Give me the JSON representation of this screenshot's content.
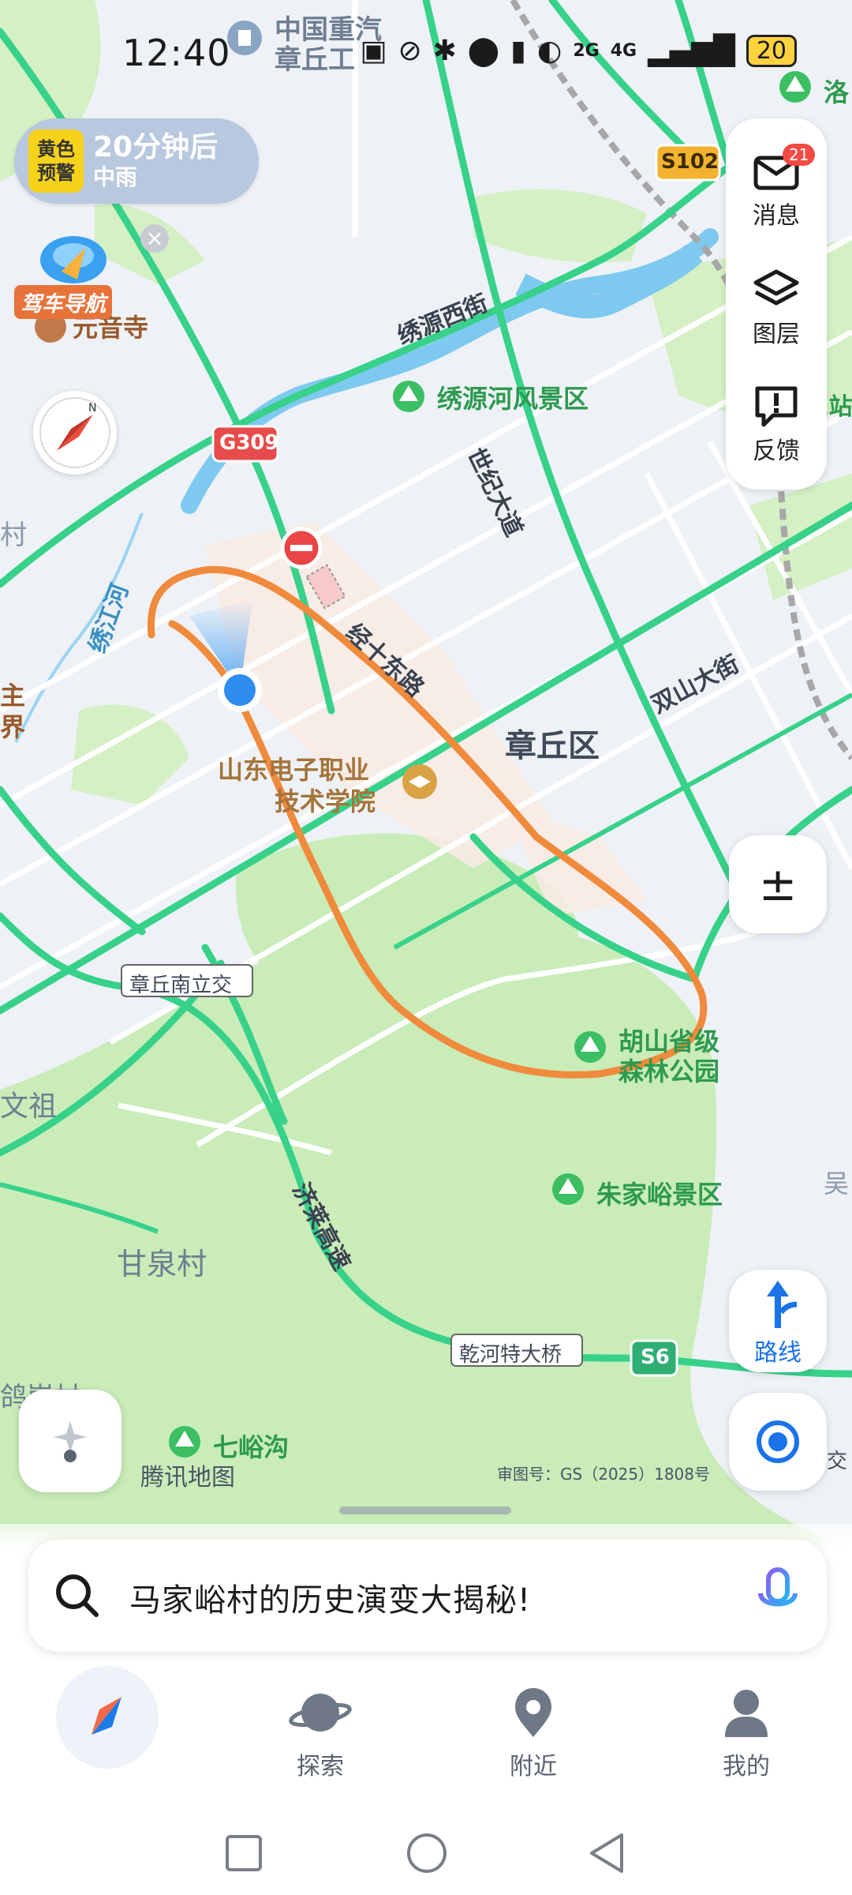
{
  "status_bar": {
    "time": "12:40",
    "icons": [
      "nfc-icon",
      "mute-icon",
      "bluetooth-icon",
      "location-icon",
      "mic-icon",
      "dnd-icon",
      "signal-icon"
    ],
    "network_1": "2G",
    "network_2": "4G",
    "battery": "20"
  },
  "weather": {
    "badge_line1": "黄色",
    "badge_line2": "预警",
    "line1": "20分钟后",
    "line2": "中雨"
  },
  "drive_nav": {
    "label": "驾车导航"
  },
  "side_panel": {
    "messages_label": "消息",
    "messages_badge": "21",
    "layers_label": "图层",
    "feedback_label": "反馈"
  },
  "controls": {
    "zoom_symbol": "±",
    "route_label": "路线"
  },
  "map": {
    "watermark": "腾讯地图",
    "approval": "审图号：GS（2025）1808号",
    "district": "章丘区",
    "roads": {
      "xiuyuan_west": "绣源西街",
      "century_ave": "世纪大道",
      "jing10_east": "经十东路",
      "shuangshan": "双山大街",
      "jiqing": "济莱高速",
      "xiujiang_river": "绣江河"
    },
    "shields": {
      "g309": "G309",
      "s102": "S102",
      "s6": "S6"
    },
    "pois": {
      "sinotruk_1": "中国重汽",
      "sinotruk_2": "章丘工",
      "temple": "元音寺",
      "xiuyuan_park": "绣源河风景区",
      "college_1": "山东电子职业",
      "college_2": "技术学院",
      "hushan_1": "胡山省级",
      "hushan_2": "森林公园",
      "zhujiayu": "朱家峪景区",
      "qiyugou": "七峪沟",
      "ganquan": "甘泉村",
      "luo": "洛",
      "interchange": "章丘南立交",
      "bridge": "乾河特大桥",
      "edge_left_1": "村",
      "edge_left_2": "主",
      "edge_left_3": "界",
      "edge_left_4": "文祖",
      "edge_left_5": "鸽崖村",
      "edge_right_1": "吴",
      "edge_right_2": "交",
      "edge_right_3": "E站"
    }
  },
  "search": {
    "query": "马家峪村的历史演变大揭秘!"
  },
  "tabs": {
    "explore": "探索",
    "nearby": "附近",
    "mine": "我的"
  },
  "colors": {
    "accent": "#1a73e8",
    "route_orange": "#f08a3c",
    "road_green": "#37d18a",
    "forest_green": "#c7eab4",
    "water_blue": "#7ec9ef"
  }
}
